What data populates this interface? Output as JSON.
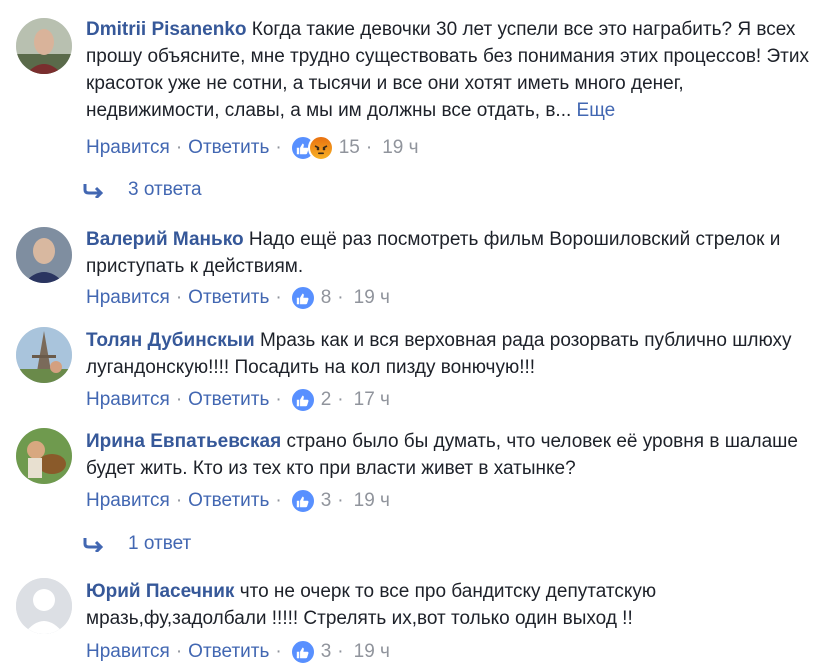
{
  "actions": {
    "like": "Нравится",
    "reply": "Ответить"
  },
  "comments": [
    {
      "author": "Dmitrii Pisanenko",
      "text": "Когда такие девочки 30 лет успели все это награбить? Я всех прошу объясните, мне трудно существовать без понимания этих процессов! Этих красоток уже не сотни, а тысячи и все они хотят иметь много денег, недвижимости, славы, а мы им должны все отдать, в...",
      "more": "Еще",
      "reactions": [
        "like",
        "angry"
      ],
      "reaction_count": "15",
      "time": "19 ч",
      "replies": "3 ответа"
    },
    {
      "author": "Валерий Манько",
      "text": "Надо ещё раз посмотреть фильм Ворошиловский стрелок и приступать к действиям.",
      "reactions": [
        "like"
      ],
      "reaction_count": "8",
      "time": "19 ч"
    },
    {
      "author": "Толян Дубинскыи",
      "text": "Мразь как и вся верховная рада розорвать публично шлюху лугандонскую!!!! Посадить на кол пизду вонючую!!!",
      "reactions": [
        "like"
      ],
      "reaction_count": "2",
      "time": "17 ч"
    },
    {
      "author": "Ирина Евпатьевская",
      "text": "страно было бы думать, что человек её уровня в шалаше будет жить. Кто из тех кто при власти живет в хатынке?",
      "reactions": [
        "like"
      ],
      "reaction_count": "3",
      "time": "19 ч",
      "replies": "1 ответ"
    },
    {
      "author": "Юрий Пасечник",
      "text": "что не очерк то все про бандитску депутатскую мразь,фу,задолбали !!!!! Стрелять их,вот только один выход !!",
      "reactions": [
        "like"
      ],
      "reaction_count": "3",
      "time": "19 ч"
    }
  ]
}
